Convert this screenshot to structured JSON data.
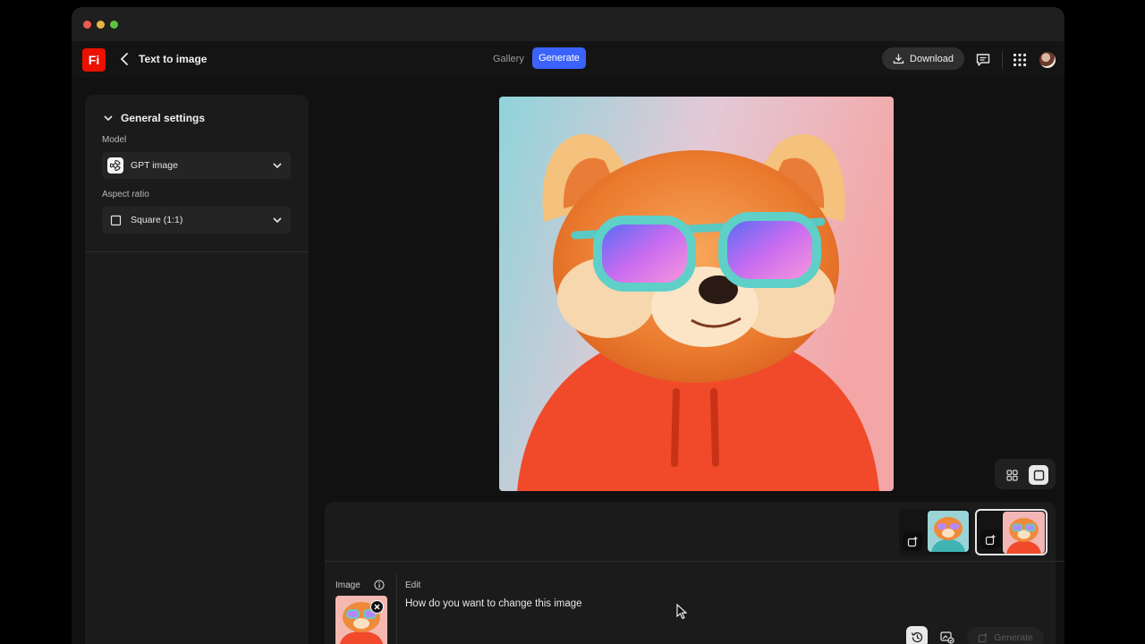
{
  "app": {
    "logo_text": "Fi",
    "page_title": "Text to image",
    "brand_color": "#eb1000",
    "accent_color": "#3b63fb"
  },
  "header": {
    "tabs": [
      {
        "label": "Gallery",
        "active": false
      },
      {
        "label": "Generate",
        "active": true
      }
    ],
    "download_label": "Download",
    "icons": [
      "chat-icon",
      "apps-grid-icon",
      "user-avatar"
    ]
  },
  "sidebar": {
    "section_title": "General settings",
    "model": {
      "label": "Model",
      "value": "GPT image",
      "icon": "openai-icon"
    },
    "aspect_ratio": {
      "label": "Aspect ratio",
      "value": "Square (1:1)",
      "icon": "square-icon"
    }
  },
  "canvas": {
    "image_description_icon": "red-panda-image",
    "view_modes": [
      "grid-view-icon",
      "single-view-icon"
    ],
    "active_view": "single-view-icon"
  },
  "history": {
    "thumbnails": [
      {
        "icon": "edit-image-icon",
        "selected": false
      },
      {
        "icon": "edit-image-icon",
        "selected": true
      }
    ]
  },
  "composer": {
    "image_label": "Image",
    "edit_label": "Edit",
    "prompt_placeholder": "How do you want to change this image",
    "generate_label": "Generate"
  }
}
